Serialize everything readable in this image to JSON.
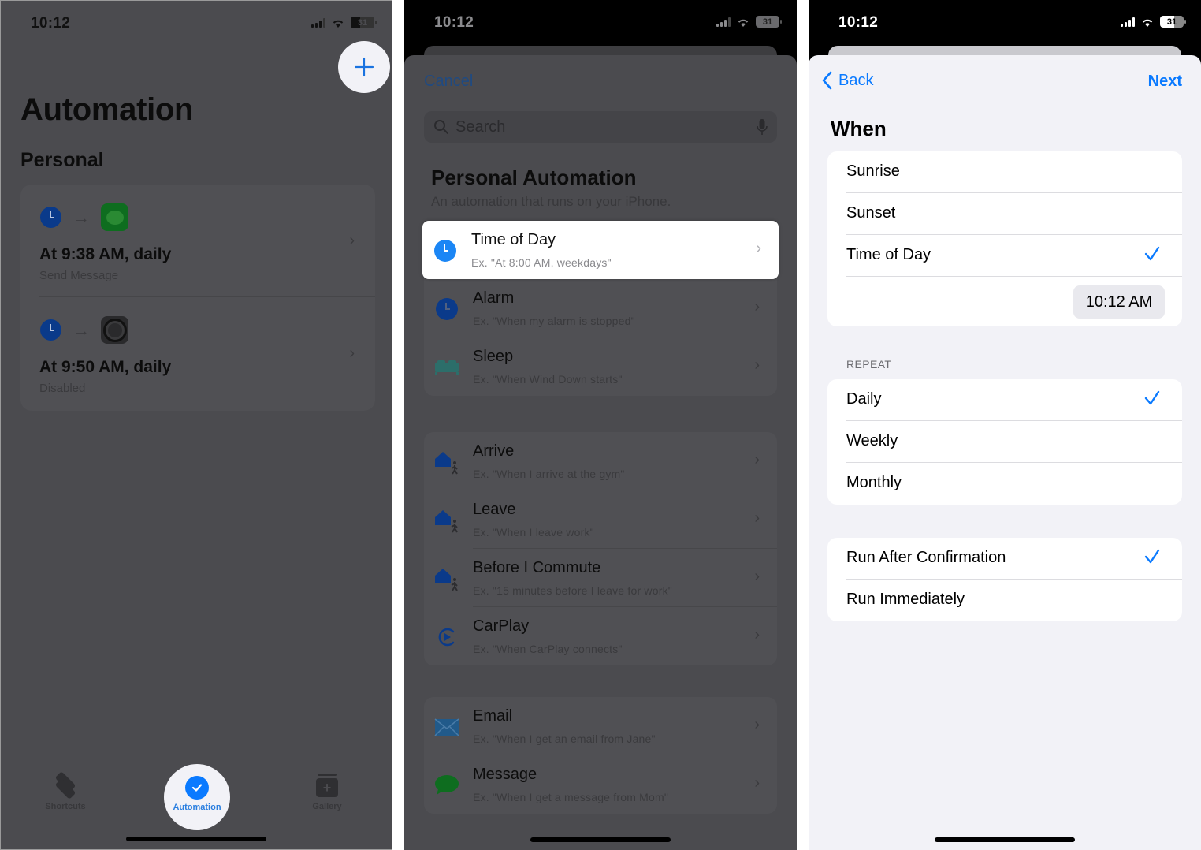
{
  "status_bar": {
    "time": "10:12",
    "battery": "31"
  },
  "panel1": {
    "title": "Automation",
    "section": "Personal",
    "automations": [
      {
        "title": "At 9:38 AM, daily",
        "subtitle": "Send Message",
        "trigger_icon": "clock-icon",
        "action_icon": "messages-app-icon"
      },
      {
        "title": "At 9:50 AM, daily",
        "subtitle": "Disabled",
        "trigger_icon": "clock-icon",
        "action_icon": "settings-app-icon"
      }
    ],
    "tabs": [
      {
        "label": "Shortcuts",
        "icon": "layers-icon",
        "selected": false
      },
      {
        "label": "Automation",
        "icon": "automation-icon",
        "selected": true
      },
      {
        "label": "Gallery",
        "icon": "gallery-icon",
        "selected": false
      }
    ]
  },
  "panel2": {
    "cancel_label": "Cancel",
    "search_placeholder": "Search",
    "title": "Personal Automation",
    "subtitle": "An automation that runs on your iPhone.",
    "groups": [
      [
        {
          "title": "Time of Day",
          "example": "Ex. \"At 8:00 AM, weekdays\"",
          "icon": "clock-icon",
          "highlighted": true
        },
        {
          "title": "Alarm",
          "example": "Ex. \"When my alarm is stopped\"",
          "icon": "alarm-clock-icon"
        },
        {
          "title": "Sleep",
          "example": "Ex. \"When Wind Down starts\"",
          "icon": "bed-icon"
        }
      ],
      [
        {
          "title": "Arrive",
          "example": "Ex. \"When I arrive at the gym\"",
          "icon": "arrive-location-icon"
        },
        {
          "title": "Leave",
          "example": "Ex. \"When I leave work\"",
          "icon": "leave-location-icon"
        },
        {
          "title": "Before I Commute",
          "example": "Ex. \"15 minutes before I leave for work\"",
          "icon": "commute-icon"
        },
        {
          "title": "CarPlay",
          "example": "Ex. \"When CarPlay connects\"",
          "icon": "carplay-icon"
        }
      ],
      [
        {
          "title": "Email",
          "example": "Ex. \"When I get an email from Jane\"",
          "icon": "email-icon"
        },
        {
          "title": "Message",
          "example": "Ex. \"When I get a message from Mom\"",
          "icon": "message-icon"
        }
      ]
    ]
  },
  "panel3": {
    "back_label": "Back",
    "next_label": "Next",
    "title": "When",
    "when_options": [
      {
        "label": "Sunrise",
        "checked": false
      },
      {
        "label": "Sunset",
        "checked": false
      },
      {
        "label": "Time of Day",
        "checked": true
      }
    ],
    "time_value": "10:12 AM",
    "repeat_header": "REPEAT",
    "repeat_options": [
      {
        "label": "Daily",
        "checked": true
      },
      {
        "label": "Weekly",
        "checked": false
      },
      {
        "label": "Monthly",
        "checked": false
      }
    ],
    "run_options": [
      {
        "label": "Run After Confirmation",
        "checked": true
      },
      {
        "label": "Run Immediately",
        "checked": false
      }
    ]
  },
  "colors": {
    "accent": "#0a7aff",
    "dim_overlay": "#4b4b4f",
    "sheet_bg": "#f2f2f7"
  }
}
